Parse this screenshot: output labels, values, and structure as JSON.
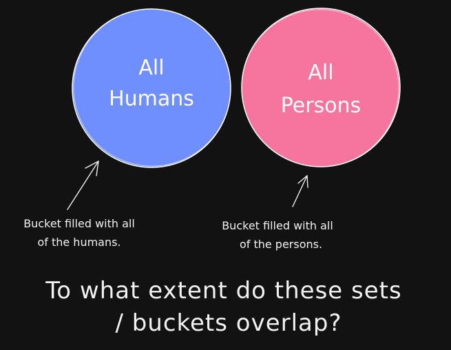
{
  "diagram": {
    "humans_circle": {
      "label_line1": "All",
      "label_line2": "Humans",
      "fill": "#6f8fff",
      "stroke": "#ffffff"
    },
    "persons_circle": {
      "label_line1": "All",
      "label_line2": "Persons",
      "fill": "#f5759f",
      "stroke": "#ffffff"
    },
    "humans_caption": {
      "line1": "Bucket filled with all",
      "line2": "of the humans."
    },
    "persons_caption": {
      "line1": "Bucket filled with all",
      "line2": "of the persons."
    },
    "question": {
      "line1": "To what extent do these sets",
      "line2": "/ buckets overlap?"
    },
    "colors": {
      "background": "#121212",
      "text": "#f2f2f2"
    }
  }
}
